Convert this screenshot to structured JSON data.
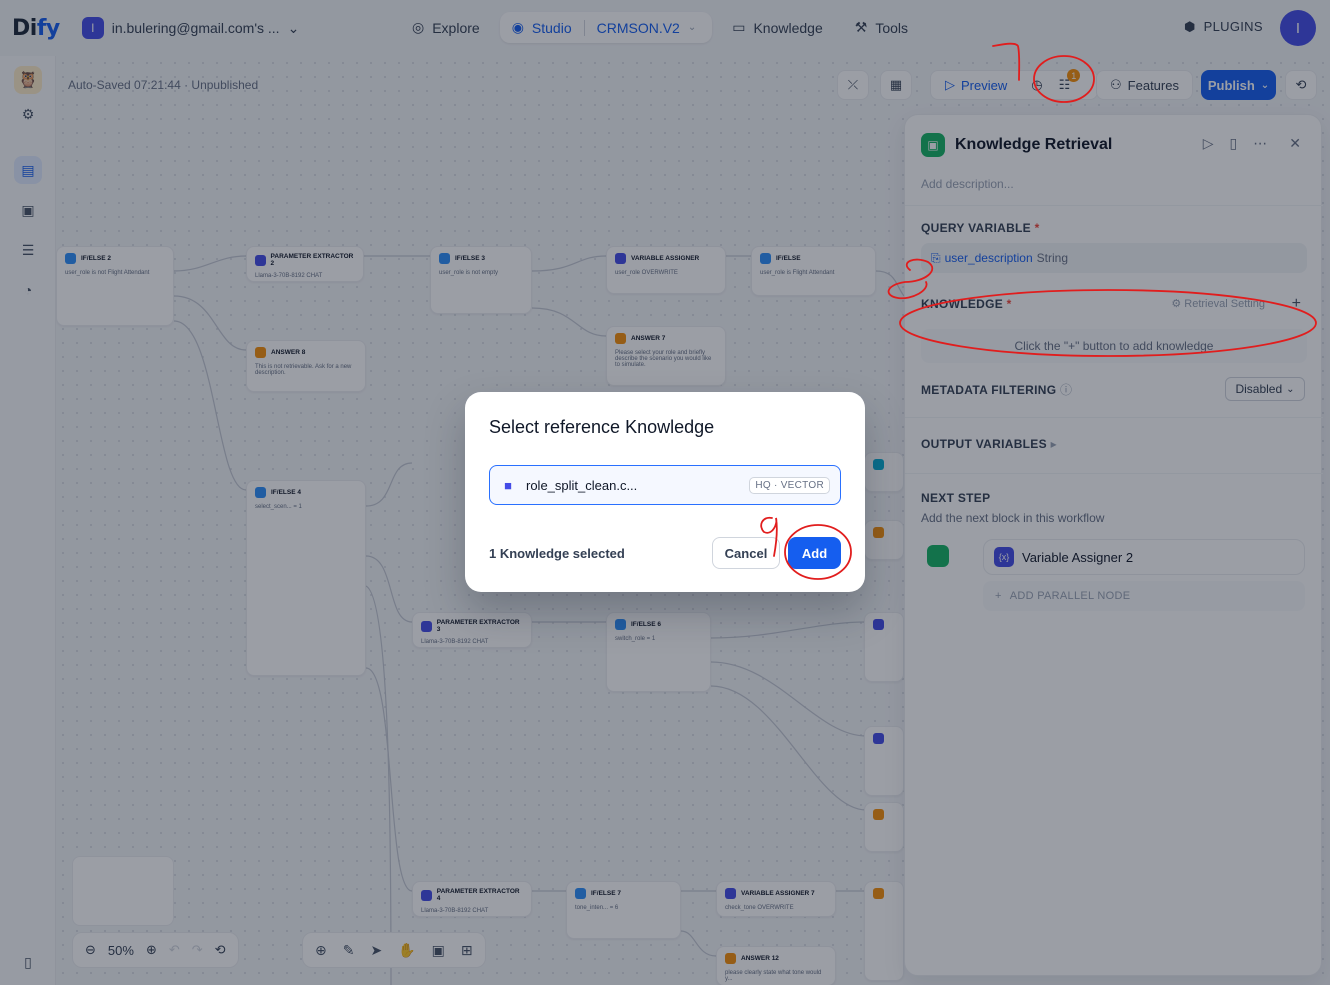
{
  "brand": {
    "name_prefix": "Di",
    "name_suffix": "fy"
  },
  "workspace": {
    "initial": "I",
    "name": "in.bulering@gmail.com's ..."
  },
  "nav": {
    "explore": "Explore",
    "studio": "Studio",
    "app_name": "CRMSON.V2",
    "knowledge": "Knowledge",
    "tools": "Tools",
    "plugins": "PLUGINS",
    "user_initial": "I"
  },
  "editor": {
    "autosave": "Auto-Saved 07:21:44 · Unpublished",
    "preview": "Preview",
    "features": "Features",
    "publish": "Publish",
    "checklist_badge": "1",
    "zoom": "50%"
  },
  "nodes": [
    {
      "id": "n1",
      "title": "IF/ELSE 2",
      "color": "blue",
      "detail": "user_role is not Flight Attendant"
    },
    {
      "id": "n2",
      "title": "PARAMETER EXTRACTOR 2",
      "color": "indigo",
      "detail": "Llama-3-70B-8192 CHAT"
    },
    {
      "id": "n3",
      "title": "IF/ELSE 3",
      "color": "blue",
      "detail": "user_role is not empty"
    },
    {
      "id": "n4",
      "title": "VARIABLE ASSIGNER",
      "color": "indigo",
      "detail": "user_role OVERWRITE"
    },
    {
      "id": "n5",
      "title": "IF/ELSE",
      "color": "blue",
      "detail": "user_role is Flight Attendant"
    },
    {
      "id": "n6",
      "title": "ANSWER 8",
      "color": "orange",
      "detail": "This is not retrievable. Ask for a new description."
    },
    {
      "id": "n7",
      "title": "ANSWER 7",
      "color": "orange",
      "detail": "Please select your role and briefly describe the scenario you would like to simulate."
    },
    {
      "id": "n8",
      "title": "IF/ELSE 4",
      "color": "blue",
      "detail": "select_scen... = 1"
    },
    {
      "id": "n9",
      "title": "PARAMETER EXTRACTOR 3",
      "color": "indigo",
      "detail": "Llama-3-70B-8192 CHAT"
    },
    {
      "id": "n10",
      "title": "IF/ELSE 6",
      "color": "blue",
      "detail": "switch_role = 1"
    },
    {
      "id": "n11",
      "title": "PARAMETER EXTRACTOR 4",
      "color": "indigo",
      "detail": "Llama-3-70B-8192 CHAT"
    },
    {
      "id": "n12",
      "title": "IF/ELSE 7",
      "color": "blue",
      "detail": "tone_inten... = 6"
    },
    {
      "id": "n13",
      "title": "VARIABLE ASSIGNER 7",
      "color": "indigo",
      "detail": "check_tone OVERWRITE"
    },
    {
      "id": "n14",
      "title": "ANSWER 12",
      "color": "orange",
      "detail": "please clearly state what tone would y..."
    }
  ],
  "panel": {
    "title": "Knowledge Retrieval",
    "description_placeholder": "Add description...",
    "query_variable_label": "QUERY VARIABLE",
    "query_variable_name": "user_description",
    "query_variable_type": "String",
    "knowledge_label": "KNOWLEDGE",
    "retrieval_setting": "Retrieval Setting",
    "knowledge_empty": "Click the \"+\" button to add knowledge",
    "metadata_label": "METADATA FILTERING",
    "metadata_value": "Disabled",
    "output_label": "OUTPUT VARIABLES",
    "next_step_label": "NEXT STEP",
    "next_step_sub": "Add the next block in this workflow",
    "next_node": "Variable Assigner 2",
    "add_parallel": "ADD PARALLEL NODE"
  },
  "modal": {
    "title": "Select reference Knowledge",
    "item_name": "role_split_clean.c...",
    "item_badge": "HQ · VECTOR",
    "selected_count": "1 Knowledge selected",
    "cancel": "Cancel",
    "add": "Add"
  },
  "colors": {
    "accent": "#155eef",
    "knowledge": "#16b364",
    "annotation": "#e11d1d"
  }
}
